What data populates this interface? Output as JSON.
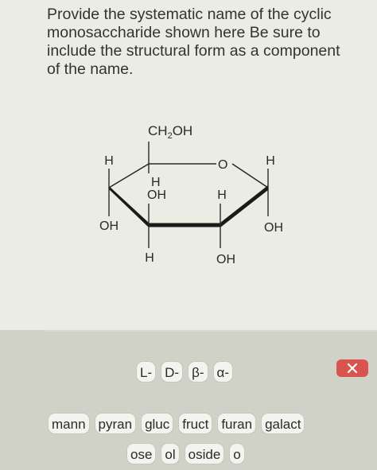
{
  "question": {
    "text": "Provide the systematic name of the cyclic\nmonosaccharide shown here Be sure to\ninclude the structural form as a component\nof the name."
  },
  "structure": {
    "labels": {
      "ch2oh_base": "CH",
      "ch2oh_sub": "2",
      "ch2oh_tail": "OH",
      "ring_o": "O",
      "c5_h": "H",
      "c1_h": "H",
      "c4_h": "H",
      "c4_oh": "OH",
      "c3_h_up": "H",
      "c1_oh": "OH",
      "c4_oh_down": "OH",
      "c3_h_down": "H",
      "c2_oh": "OH"
    }
  },
  "answer_bank": {
    "clear_icon": "clear-x-icon",
    "row1": [
      "L-",
      "D-",
      "β-",
      "α-"
    ],
    "row2": [
      "mann",
      "pyran",
      "gluc",
      "fruct",
      "furan",
      "galact"
    ],
    "row3": [
      "ose",
      "ol",
      "oside",
      "o"
    ]
  },
  "colors": {
    "accent_red": "#d9534f",
    "panel": "#ebece4",
    "bank_bg": "#d0d2c7"
  }
}
